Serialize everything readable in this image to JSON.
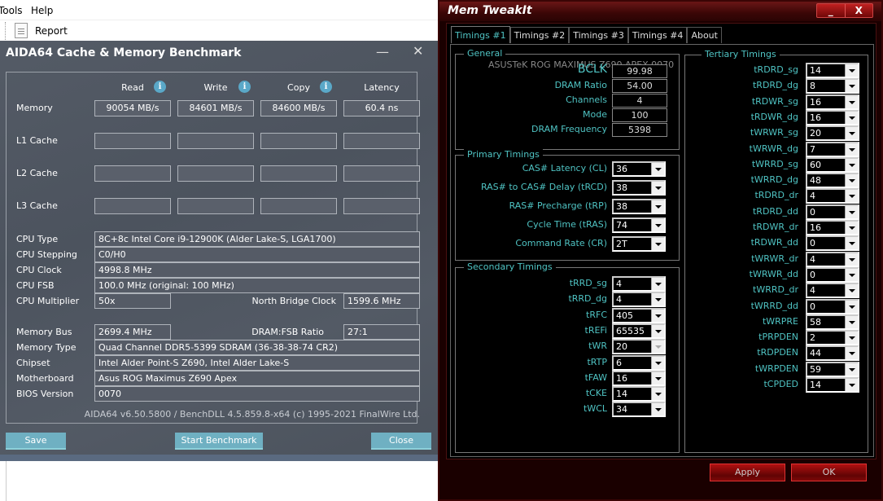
{
  "background_app": {
    "menu": [
      "Tools",
      "Help"
    ],
    "toolbar": {
      "report_label": "Report"
    }
  },
  "aida": {
    "title": "AIDA64 Cache & Memory Benchmark",
    "columns": [
      "Read",
      "Write",
      "Copy",
      "Latency"
    ],
    "rows": [
      {
        "label": "Memory",
        "values": [
          "90054 MB/s",
          "84601 MB/s",
          "84600 MB/s",
          "60.4 ns"
        ]
      },
      {
        "label": "L1 Cache",
        "values": [
          "",
          "",
          "",
          ""
        ]
      },
      {
        "label": "L2 Cache",
        "values": [
          "",
          "",
          "",
          ""
        ]
      },
      {
        "label": "L3 Cache",
        "values": [
          "",
          "",
          "",
          ""
        ]
      }
    ],
    "info": {
      "cpu_type_label": "CPU Type",
      "cpu_type": "8C+8c Intel Core i9-12900K  (Alder Lake-S, LGA1700)",
      "cpu_stepping_label": "CPU Stepping",
      "cpu_stepping": "C0/H0",
      "cpu_clock_label": "CPU Clock",
      "cpu_clock": "4998.8 MHz",
      "cpu_fsb_label": "CPU FSB",
      "cpu_fsb": "100.0 MHz  (original: 100 MHz)",
      "cpu_mult_label": "CPU Multiplier",
      "cpu_mult": "50x",
      "nb_clock_label": "North Bridge Clock",
      "nb_clock": "1599.6 MHz",
      "mem_bus_label": "Memory Bus",
      "mem_bus": "2699.4 MHz",
      "dram_fsb_label": "DRAM:FSB Ratio",
      "dram_fsb": "27:1",
      "mem_type_label": "Memory Type",
      "mem_type": "Quad Channel DDR5-5399 SDRAM  (36-38-38-74 CR2)",
      "chipset_label": "Chipset",
      "chipset": "Intel Alder Point-S Z690, Intel Alder Lake-S",
      "mobo_label": "Motherboard",
      "mobo": "Asus ROG Maximus Z690 Apex",
      "bios_label": "BIOS Version",
      "bios": "0070"
    },
    "footer": "AIDA64 v6.50.5800 / BenchDLL 4.5.859.8-x64  (c) 1995-2021 FinalWire Ltd.",
    "buttons": {
      "save": "Save",
      "start": "Start Benchmark",
      "close": "Close"
    }
  },
  "memtweakit": {
    "title": "Mem TweakIt",
    "tabs": [
      "Timings #1",
      "Timings #2",
      "Timings #3",
      "Timings #4",
      "About"
    ],
    "active_tab": "Timings #1",
    "general": {
      "title": "General",
      "board": "ASUSTeK ROG MAXIMUS Z690 APEX 0070",
      "fields": [
        {
          "label": "BCLK",
          "value": "99.98"
        },
        {
          "label": "DRAM Ratio",
          "value": "54.00"
        },
        {
          "label": "Channels",
          "value": "4"
        },
        {
          "label": "Mode",
          "value": "100"
        },
        {
          "label": "DRAM Frequency",
          "value": "5398"
        }
      ]
    },
    "primary": {
      "title": "Primary Timings",
      "fields": [
        {
          "label": "CAS# Latency (CL)",
          "value": "36"
        },
        {
          "label": "RAS# to CAS# Delay (tRCD)",
          "value": "38"
        },
        {
          "label": "RAS# Precharge (tRP)",
          "value": "38"
        },
        {
          "label": "Cycle Time (tRAS)",
          "value": "74"
        },
        {
          "label": "Command Rate (CR)",
          "value": "2T"
        }
      ]
    },
    "secondary": {
      "title": "Secondary Timings",
      "fields": [
        {
          "label": "tRRD_sg",
          "value": "4"
        },
        {
          "label": "tRRD_dg",
          "value": "4"
        },
        {
          "label": "tRFC",
          "value": "405"
        },
        {
          "label": "tREFi",
          "value": "65535"
        },
        {
          "label": "tWR",
          "value": "20",
          "disabled": true
        },
        {
          "label": "tRTP",
          "value": "6"
        },
        {
          "label": "tFAW",
          "value": "16"
        },
        {
          "label": "tCKE",
          "value": "14"
        },
        {
          "label": "tWCL",
          "value": "34"
        }
      ]
    },
    "tertiary": {
      "title": "Tertiary Timings",
      "fields": [
        {
          "label": "tRDRD_sg",
          "value": "14"
        },
        {
          "label": "tRDRD_dg",
          "value": "8"
        },
        {
          "label": "tRDWR_sg",
          "value": "16"
        },
        {
          "label": "tRDWR_dg",
          "value": "16"
        },
        {
          "label": "tWRWR_sg",
          "value": "20"
        },
        {
          "label": "tWRWR_dg",
          "value": "7"
        },
        {
          "label": "tWRRD_sg",
          "value": "60"
        },
        {
          "label": "tWRRD_dg",
          "value": "48"
        },
        {
          "label": "tRDRD_dr",
          "value": "4"
        },
        {
          "label": "tRDRD_dd",
          "value": "0"
        },
        {
          "label": "tRDWR_dr",
          "value": "16"
        },
        {
          "label": "tRDWR_dd",
          "value": "0"
        },
        {
          "label": "tWRWR_dr",
          "value": "4"
        },
        {
          "label": "tWRWR_dd",
          "value": "0"
        },
        {
          "label": "tWRRD_dr",
          "value": "4"
        },
        {
          "label": "tWRRD_dd",
          "value": "0"
        },
        {
          "label": "tWRPRE",
          "value": "58"
        },
        {
          "label": "tPRPDEN",
          "value": "2"
        },
        {
          "label": "tRDPDEN",
          "value": "44"
        },
        {
          "label": "tWRPDEN",
          "value": "59"
        },
        {
          "label": "tCPDED",
          "value": "14"
        }
      ]
    },
    "buttons": {
      "apply": "Apply",
      "ok": "OK"
    },
    "window_buttons": {
      "minimize": "_",
      "close": "X"
    }
  }
}
